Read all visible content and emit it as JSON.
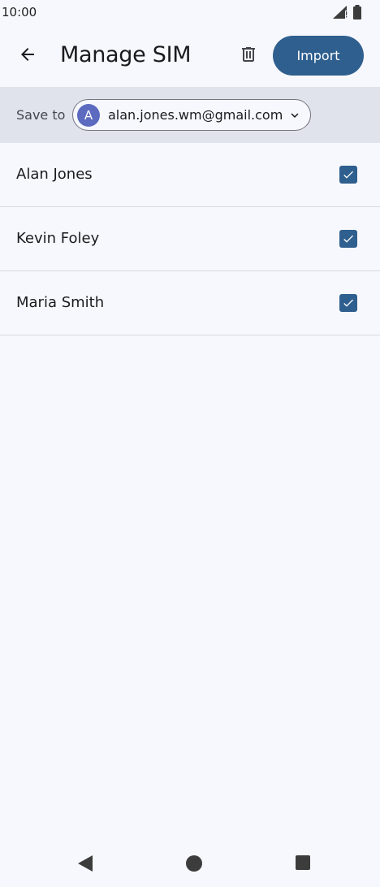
{
  "status": {
    "time": "10:00",
    "icons": [
      "signal-icon",
      "battery-icon"
    ]
  },
  "appbar": {
    "title": "Manage SIM",
    "back_icon": "arrow-back-icon",
    "delete_icon": "trash-icon",
    "import_label": "Import"
  },
  "save_to": {
    "label": "Save to",
    "avatar_letter": "A",
    "account": "alan.jones.wm@gmail.com",
    "dropdown_icon": "chevron-down-icon"
  },
  "contacts": [
    {
      "name": "Alan Jones",
      "checked": true
    },
    {
      "name": "Kevin Foley",
      "checked": true
    },
    {
      "name": "Maria Smith",
      "checked": true
    }
  ],
  "colors": {
    "accent": "#2f5f8e",
    "background": "#f7f8fd",
    "bar": "#e1e3ec",
    "avatar": "#5c6bc0"
  },
  "navbar": {
    "icons": [
      "back-triangle-icon",
      "home-circle-icon",
      "recents-square-icon"
    ]
  }
}
